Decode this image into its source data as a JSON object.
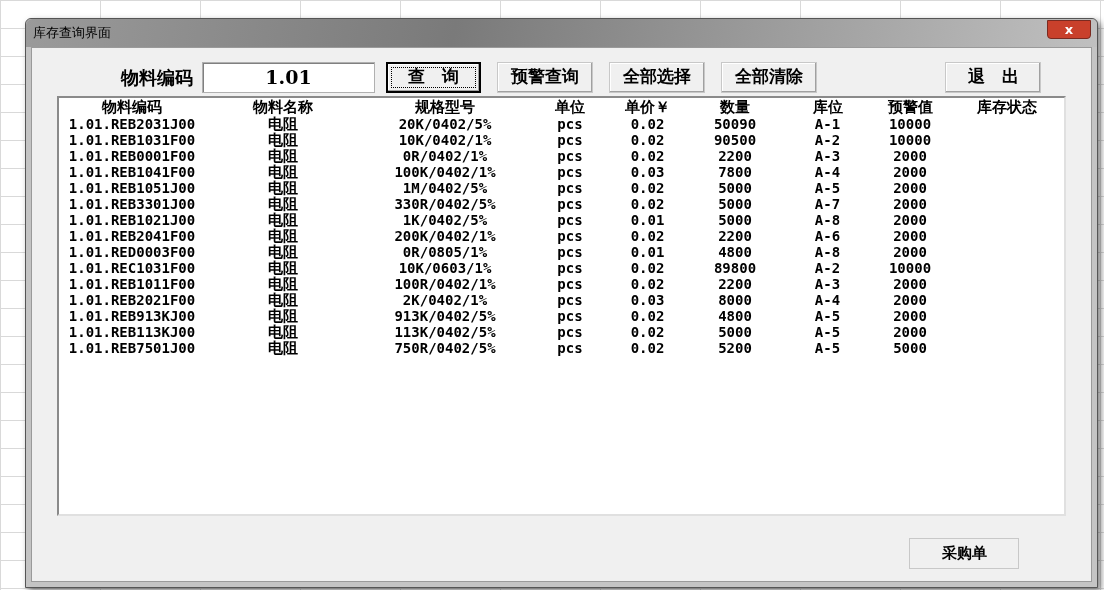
{
  "window": {
    "title": "库存查询界面",
    "close": "x"
  },
  "search": {
    "label": "物料编码",
    "value": "1.01"
  },
  "buttons": [
    {
      "label": "查　询",
      "focused": true
    },
    {
      "label": "预警查询",
      "focused": false
    },
    {
      "label": "全部选择",
      "focused": false
    },
    {
      "label": "全部清除",
      "focused": false
    },
    {
      "label": "退　出",
      "focused": false
    }
  ],
  "table": {
    "columns": [
      "物料编码",
      "物料名称",
      "规格型号",
      "单位",
      "单价￥",
      "数量",
      "库位",
      "预警值",
      "库存状态"
    ],
    "rows": [
      [
        "1.01.REB2031J00",
        "电阻",
        "20K/0402/5%",
        "pcs",
        "0.02",
        "50090",
        "A-1",
        "10000"
      ],
      [
        "1.01.REB1031F00",
        "电阻",
        "10K/0402/1%",
        "pcs",
        "0.02",
        "90500",
        "A-2",
        "10000"
      ],
      [
        "1.01.REB0001F00",
        "电阻",
        "0R/0402/1%",
        "pcs",
        "0.02",
        "2200",
        "A-3",
        "2000"
      ],
      [
        "1.01.REB1041F00",
        "电阻",
        "100K/0402/1%",
        "pcs",
        "0.03",
        "7800",
        "A-4",
        "2000"
      ],
      [
        "1.01.REB1051J00",
        "电阻",
        "1M/0402/5%",
        "pcs",
        "0.02",
        "5000",
        "A-5",
        "2000"
      ],
      [
        "1.01.REB3301J00",
        "电阻",
        "330R/0402/5%",
        "pcs",
        "0.02",
        "5000",
        "A-7",
        "2000"
      ],
      [
        "1.01.REB1021J00",
        "电阻",
        "1K/0402/5%",
        "pcs",
        "0.01",
        "5000",
        "A-8",
        "2000"
      ],
      [
        "1.01.REB2041F00",
        "电阻",
        "200K/0402/1%",
        "pcs",
        "0.02",
        "2200",
        "A-6",
        "2000"
      ],
      [
        "1.01.RED0003F00",
        "电阻",
        "0R/0805/1%",
        "pcs",
        "0.01",
        "4800",
        "A-8",
        "2000"
      ],
      [
        "1.01.REC1031F00",
        "电阻",
        "10K/0603/1%",
        "pcs",
        "0.02",
        "89800",
        "A-2",
        "10000"
      ],
      [
        "1.01.REB1011F00",
        "电阻",
        "100R/0402/1%",
        "pcs",
        "0.02",
        "2200",
        "A-3",
        "2000"
      ],
      [
        "1.01.REB2021F00",
        "电阻",
        "2K/0402/1%",
        "pcs",
        "0.03",
        "8000",
        "A-4",
        "2000"
      ],
      [
        "1.01.REB913KJ00",
        "电阻",
        "913K/0402/5%",
        "pcs",
        "0.02",
        "4800",
        "A-5",
        "2000"
      ],
      [
        "1.01.REB113KJ00",
        "电阻",
        "113K/0402/5%",
        "pcs",
        "0.02",
        "5000",
        "A-5",
        "2000"
      ],
      [
        "1.01.REB7501J00",
        "电阻",
        "750R/0402/5%",
        "pcs",
        "0.02",
        "5200",
        "A-5",
        "5000"
      ]
    ]
  },
  "bottom_button": {
    "label": "采购单"
  }
}
